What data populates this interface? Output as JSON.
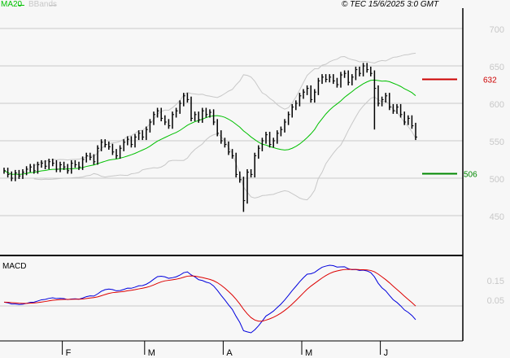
{
  "header": {
    "ma_label": "MA20",
    "bb_label": "BBands",
    "copyright": "© TEC 15/6/2025 3:0 GMT"
  },
  "colors": {
    "ma": "#00c000",
    "bb": "#c8c8c8",
    "macd": "#0000dd",
    "signal": "#dd0000",
    "resistance": "#cc0000",
    "support": "#008800"
  },
  "chart_data": {
    "type": "ohlc",
    "price_axis": {
      "ticks": [
        700,
        650,
        600,
        550,
        500,
        450
      ],
      "ylim": [
        418,
        721
      ]
    },
    "macd_axis": {
      "ticks": [
        "0.15",
        "0.05"
      ]
    },
    "months": [
      "F",
      "M",
      "A",
      "M",
      "J"
    ],
    "month_start_index": [
      16,
      38,
      59,
      80,
      101
    ],
    "levels": [
      {
        "value": 632,
        "label": "632",
        "type": "resistance"
      },
      {
        "value": 506,
        "label": "506",
        "type": "support"
      }
    ],
    "close": [
      510,
      505,
      500,
      507,
      503,
      508,
      512,
      515,
      510,
      518,
      520,
      516,
      522,
      520,
      512,
      518,
      515,
      510,
      520,
      518,
      515,
      525,
      530,
      528,
      522,
      540,
      548,
      545,
      542,
      535,
      530,
      540,
      548,
      552,
      545,
      555,
      560,
      555,
      565,
      575,
      585,
      590,
      580,
      575,
      570,
      585,
      590,
      600,
      610,
      605,
      580,
      585,
      578,
      590,
      585,
      588,
      575,
      560,
      550,
      545,
      535,
      530,
      505,
      498,
      470,
      508,
      505,
      530,
      540,
      550,
      558,
      545,
      550,
      560,
      565,
      575,
      585,
      595,
      600,
      610,
      615,
      620,
      605,
      615,
      630,
      635,
      632,
      635,
      630,
      625,
      638,
      640,
      628,
      635,
      645,
      640,
      650,
      645,
      640,
      620,
      600,
      605,
      610,
      595,
      590,
      595,
      585,
      575,
      580,
      570,
      555
    ],
    "low_overrides": {
      "64": 455,
      "99": 565
    },
    "indicators": [
      "MA20",
      "BBands(20,2)",
      "MACD(12,26,9)"
    ],
    "macd_title": "MACD"
  }
}
